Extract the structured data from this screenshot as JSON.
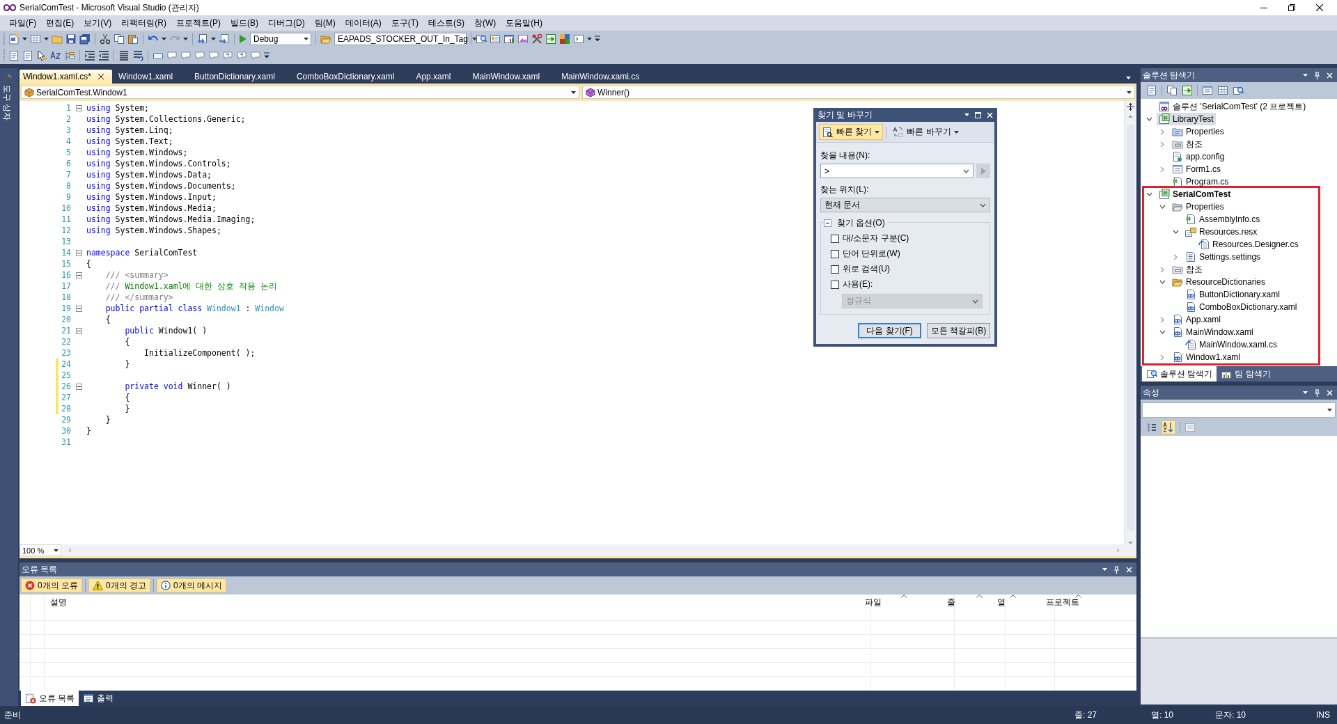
{
  "window": {
    "title": "SerialComTest - Microsoft Visual Studio (관리자)"
  },
  "menu": [
    "파일(F)",
    "편집(E)",
    "보기(V)",
    "리팩터링(R)",
    "프로젝트(P)",
    "빌드(B)",
    "디버그(D)",
    "팀(M)",
    "데이터(A)",
    "도구(T)",
    "테스트(S)",
    "창(W)",
    "도움말(H)"
  ],
  "toolbar": {
    "configuration": "Debug",
    "find_combo": "EAPADS_STOCKER_OUT_In_Tag"
  },
  "left_strip": {
    "label": "도구 상자"
  },
  "editor": {
    "tabs": [
      {
        "label": "Window1.xaml.cs*",
        "selected": true
      },
      {
        "label": "Window1.xaml",
        "selected": false
      },
      {
        "label": "ButtonDictionary.xaml",
        "selected": false
      },
      {
        "label": "ComboBoxDictionary.xaml",
        "selected": false
      },
      {
        "label": "App.xaml",
        "selected": false
      },
      {
        "label": "MainWindow.xaml",
        "selected": false
      },
      {
        "label": "MainWindow.xaml.cs",
        "selected": false
      }
    ],
    "type_combo": "SerialComTest.Window1",
    "member_combo": "Winner()",
    "zoom": "100 %",
    "lines": [
      {
        "number": "1",
        "fold": true,
        "changed": false,
        "tokens": [
          {
            "kind": "keyword",
            "text": "using"
          },
          {
            "kind": "plain",
            "text": " System;"
          }
        ]
      },
      {
        "number": "2",
        "fold": false,
        "changed": false,
        "tokens": [
          {
            "kind": "keyword",
            "text": "using"
          },
          {
            "kind": "plain",
            "text": " System.Collections.Generic;"
          }
        ]
      },
      {
        "number": "3",
        "fold": false,
        "changed": false,
        "tokens": [
          {
            "kind": "keyword",
            "text": "using"
          },
          {
            "kind": "plain",
            "text": " System.Linq;"
          }
        ]
      },
      {
        "number": "4",
        "fold": false,
        "changed": false,
        "tokens": [
          {
            "kind": "keyword",
            "text": "using"
          },
          {
            "kind": "plain",
            "text": " System.Text;"
          }
        ]
      },
      {
        "number": "5",
        "fold": false,
        "changed": false,
        "tokens": [
          {
            "kind": "keyword",
            "text": "using"
          },
          {
            "kind": "plain",
            "text": " System.Windows;"
          }
        ]
      },
      {
        "number": "6",
        "fold": false,
        "changed": false,
        "tokens": [
          {
            "kind": "keyword",
            "text": "using"
          },
          {
            "kind": "plain",
            "text": " System.Windows.Controls;"
          }
        ]
      },
      {
        "number": "7",
        "fold": false,
        "changed": false,
        "tokens": [
          {
            "kind": "keyword",
            "text": "using"
          },
          {
            "kind": "plain",
            "text": " System.Windows.Data;"
          }
        ]
      },
      {
        "number": "8",
        "fold": false,
        "changed": false,
        "tokens": [
          {
            "kind": "keyword",
            "text": "using"
          },
          {
            "kind": "plain",
            "text": " System.Windows.Documents;"
          }
        ]
      },
      {
        "number": "9",
        "fold": false,
        "changed": false,
        "tokens": [
          {
            "kind": "keyword",
            "text": "using"
          },
          {
            "kind": "plain",
            "text": " System.Windows.Input;"
          }
        ]
      },
      {
        "number": "10",
        "fold": false,
        "changed": false,
        "tokens": [
          {
            "kind": "keyword",
            "text": "using"
          },
          {
            "kind": "plain",
            "text": " System.Windows.Media;"
          }
        ]
      },
      {
        "number": "11",
        "fold": false,
        "changed": false,
        "tokens": [
          {
            "kind": "keyword",
            "text": "using"
          },
          {
            "kind": "plain",
            "text": " System.Windows.Media.Imaging;"
          }
        ]
      },
      {
        "number": "12",
        "fold": false,
        "changed": false,
        "tokens": [
          {
            "kind": "keyword",
            "text": "using"
          },
          {
            "kind": "plain",
            "text": " System.Windows.Shapes;"
          }
        ]
      },
      {
        "number": "13",
        "fold": false,
        "changed": false
      },
      {
        "number": "14",
        "fold": true,
        "changed": false,
        "tokens": [
          {
            "kind": "keyword",
            "text": "namespace"
          },
          {
            "kind": "plain",
            "text": " SerialComTest"
          }
        ]
      },
      {
        "number": "15",
        "fold": false,
        "changed": false,
        "tokens": [
          {
            "kind": "plain",
            "text": "{"
          }
        ]
      },
      {
        "number": "16",
        "fold": true,
        "changed": false,
        "tokens": [
          {
            "kind": "doc",
            "text": "    /// <summary>"
          }
        ]
      },
      {
        "number": "17",
        "fold": false,
        "changed": false,
        "tokens": [
          {
            "kind": "doc",
            "text": "    ///"
          },
          {
            "kind": "comment",
            "text": " Window1.xaml에 대한 상호 작용 논리"
          }
        ]
      },
      {
        "number": "18",
        "fold": false,
        "changed": false,
        "tokens": [
          {
            "kind": "doc",
            "text": "    /// </summary>"
          }
        ]
      },
      {
        "number": "19",
        "fold": true,
        "changed": false,
        "tokens": [
          {
            "kind": "keyword",
            "text": "    public partial class"
          },
          {
            "kind": "type",
            "text": " Window1"
          },
          {
            "kind": "plain",
            "text": " : "
          },
          {
            "kind": "type",
            "text": "Window"
          }
        ]
      },
      {
        "number": "20",
        "fold": false,
        "changed": false,
        "tokens": [
          {
            "kind": "plain",
            "text": "    {"
          }
        ]
      },
      {
        "number": "21",
        "fold": true,
        "changed": false,
        "tokens": [
          {
            "kind": "keyword",
            "text": "        public"
          },
          {
            "kind": "plain",
            "text": " Window1( )"
          }
        ]
      },
      {
        "number": "22",
        "fold": false,
        "changed": false,
        "tokens": [
          {
            "kind": "plain",
            "text": "        {"
          }
        ]
      },
      {
        "number": "23",
        "fold": false,
        "changed": false,
        "tokens": [
          {
            "kind": "plain",
            "text": "            InitializeComponent( );"
          }
        ]
      },
      {
        "number": "24",
        "fold": false,
        "changed": true,
        "tokens": [
          {
            "kind": "plain",
            "text": "        }"
          }
        ]
      },
      {
        "number": "25",
        "fold": false,
        "changed": true
      },
      {
        "number": "26",
        "fold": true,
        "changed": true,
        "tokens": [
          {
            "kind": "keyword",
            "text": "        private void"
          },
          {
            "kind": "plain",
            "text": " Winner( )"
          }
        ]
      },
      {
        "number": "27",
        "fold": false,
        "changed": true,
        "tokens": [
          {
            "kind": "plain",
            "text": "        {"
          }
        ]
      },
      {
        "number": "28",
        "fold": false,
        "changed": true,
        "tokens": [
          {
            "kind": "plain",
            "text": "        }"
          }
        ]
      },
      {
        "number": "29",
        "fold": false,
        "changed": false,
        "tokens": [
          {
            "kind": "plain",
            "text": "    }"
          }
        ]
      },
      {
        "number": "30",
        "fold": false,
        "changed": false,
        "tokens": [
          {
            "kind": "plain",
            "text": "}"
          }
        ]
      },
      {
        "number": "31",
        "fold": false,
        "changed": false
      }
    ]
  },
  "find_dialog": {
    "title": "찾기 및 바꾸기",
    "modes": [
      {
        "label": "빠른 찾기",
        "selected": true
      },
      {
        "label": "빠른 바꾸기",
        "selected": false
      }
    ],
    "find_label": "찾을 내용(N):",
    "find_value": ">",
    "look_in_label": "찾는 위치(L):",
    "look_in_value": "현재 문서",
    "options_label": "찾기 옵션(O)",
    "options_expanded": true,
    "options": [
      {
        "label": "대/소문자 구분(C)",
        "checked": false
      },
      {
        "label": "단어 단위로(W)",
        "checked": false
      },
      {
        "label": "위로 검색(U)",
        "checked": false
      },
      {
        "label": "사용(E):",
        "checked": false
      }
    ],
    "syntax_value": "정규식",
    "syntax_disabled": true,
    "buttons": [
      {
        "label": "다음 찾기(F)",
        "selected": true
      },
      {
        "label": "모든 책갈피(B)",
        "selected": false
      }
    ]
  },
  "solution_explorer": {
    "title": "솔루션 탐색기",
    "tree": {
      "label": "솔루션 'SerialComTest' (2 프로젝트)",
      "kind": "solution",
      "selected": false,
      "children": [
        {
          "label": "LibraryTest",
          "kind": "project",
          "selected": true,
          "startup": false,
          "highlighted": false,
          "expanded": true,
          "children": [
            {
              "label": "Properties",
              "kind": "properties",
              "selected": false,
              "expanded": false
            },
            {
              "label": "참조",
              "kind": "references",
              "selected": false,
              "expanded": false
            },
            {
              "label": "app.config",
              "kind": "config",
              "selected": false
            },
            {
              "label": "Form1.cs",
              "kind": "form",
              "selected": false,
              "expanded": false
            },
            {
              "label": "Program.cs",
              "kind": "csfile",
              "selected": false
            }
          ]
        },
        {
          "label": "SerialComTest",
          "kind": "project",
          "selected": false,
          "startup": true,
          "highlighted": true,
          "expanded": true,
          "children": [
            {
              "label": "Properties",
              "kind": "open_properties",
              "selected": false,
              "expanded": true,
              "children": [
                {
                  "label": "AssemblyInfo.cs",
                  "kind": "csfile",
                  "selected": false
                },
                {
                  "label": "Resources.resx",
                  "kind": "resx",
                  "selected": false,
                  "expanded": true,
                  "children": [
                    {
                      "label": "Resources.Designer.cs",
                      "kind": "codebehind",
                      "selected": false
                    }
                  ]
                },
                {
                  "label": "Settings.settings",
                  "kind": "settings",
                  "selected": false,
                  "expanded": false
                }
              ]
            },
            {
              "label": "참조",
              "kind": "references",
              "selected": false,
              "expanded": false
            },
            {
              "label": "ResourceDictionaries",
              "kind": "open_folder",
              "selected": false,
              "expanded": true,
              "children": [
                {
                  "label": "ButtonDictionary.xaml",
                  "kind": "xaml",
                  "selected": false
                },
                {
                  "label": "ComboBoxDictionary.xaml",
                  "kind": "xaml",
                  "selected": false
                }
              ]
            },
            {
              "label": "App.xaml",
              "kind": "xaml",
              "selected": false,
              "expanded": false
            },
            {
              "label": "MainWindow.xaml",
              "kind": "xaml",
              "selected": false,
              "expanded": true,
              "children": [
                {
                  "label": "MainWindow.xaml.cs",
                  "kind": "codebehind",
                  "selected": false
                }
              ]
            },
            {
              "label": "Window1.xaml",
              "kind": "xaml",
              "selected": false,
              "expanded": false
            }
          ]
        }
      ]
    },
    "tabs": [
      {
        "label": "솔루션 탐색기",
        "selected": true
      },
      {
        "label": "팀 탐색기",
        "selected": false
      }
    ]
  },
  "properties": {
    "title": "속성"
  },
  "error_list": {
    "title": "오류 목록",
    "filters": [
      {
        "kind": "error",
        "label": "0개의 오류",
        "selected": true
      },
      {
        "kind": "warning",
        "label": "0개의 경고",
        "selected": true
      },
      {
        "kind": "info",
        "label": "0개의 메시지",
        "selected": true
      }
    ],
    "columns": [
      {
        "label": "설명",
        "sortable": false
      },
      {
        "label": "파일",
        "sortable": true
      },
      {
        "label": "줄",
        "sortable": true
      },
      {
        "label": "열",
        "sortable": true
      },
      {
        "label": "프로젝트",
        "sortable": true
      }
    ],
    "tabs": [
      {
        "kind": "errors",
        "label": "오류 목록",
        "selected": true
      },
      {
        "kind": "output",
        "label": "출력",
        "selected": false
      }
    ]
  },
  "status_bar": {
    "message": "준비",
    "line": "줄: 27",
    "column": "열: 10",
    "char": "문자: 10",
    "mode": "INS"
  }
}
